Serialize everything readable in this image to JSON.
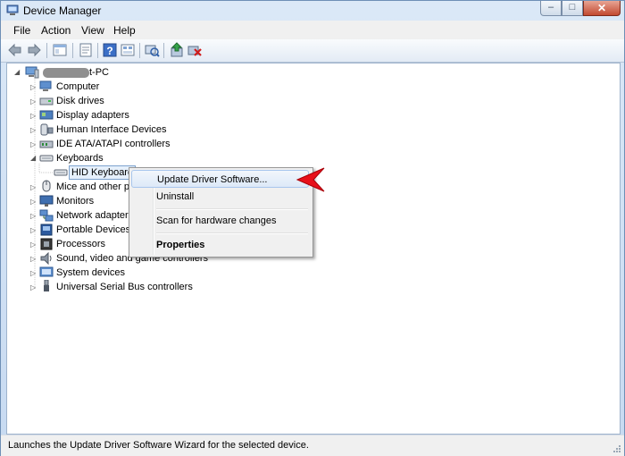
{
  "window": {
    "title": "Device Manager",
    "minimize": "–",
    "maximize": "□",
    "close": "✕"
  },
  "menu": [
    "File",
    "Action",
    "View",
    "Help"
  ],
  "toolbar": [
    "back-icon",
    "forward-icon",
    "up-icon",
    "properties-icon",
    "help-icon",
    "view-icon",
    "scan-hardware-icon",
    "update-driver-icon",
    "uninstall-icon"
  ],
  "tree": {
    "root": "t-PC",
    "items": [
      {
        "label": "Computer",
        "icon": "computer-icon"
      },
      {
        "label": "Disk drives",
        "icon": "disk-icon"
      },
      {
        "label": "Display adapters",
        "icon": "display-icon"
      },
      {
        "label": "Human Interface Devices",
        "icon": "hid-icon"
      },
      {
        "label": "IDE ATA/ATAPI controllers",
        "icon": "ide-icon"
      },
      {
        "label": "Keyboards",
        "icon": "keyboard-icon",
        "expanded": true,
        "children": [
          {
            "label": "HID Keyboard",
            "icon": "keyboard-icon"
          }
        ]
      },
      {
        "label": "Mice and other p",
        "icon": "mouse-icon"
      },
      {
        "label": "Monitors",
        "icon": "monitor-icon"
      },
      {
        "label": "Network adapters",
        "icon": "network-icon"
      },
      {
        "label": "Portable Devices",
        "icon": "portable-icon"
      },
      {
        "label": "Processors",
        "icon": "processor-icon"
      },
      {
        "label": "Sound, video and game controllers",
        "icon": "sound-icon"
      },
      {
        "label": "System devices",
        "icon": "system-icon"
      },
      {
        "label": "Universal Serial Bus controllers",
        "icon": "usb-icon"
      }
    ]
  },
  "context_menu": {
    "items": [
      "Update Driver Software...",
      "Uninstall",
      "Scan for hardware changes",
      "Properties"
    ],
    "highlighted": "Update Driver Software..."
  },
  "status": "Launches the Update Driver Software Wizard for the selected device.",
  "colors": {
    "accent_arrow": "#e8101a",
    "selection": "#cde3fa"
  }
}
